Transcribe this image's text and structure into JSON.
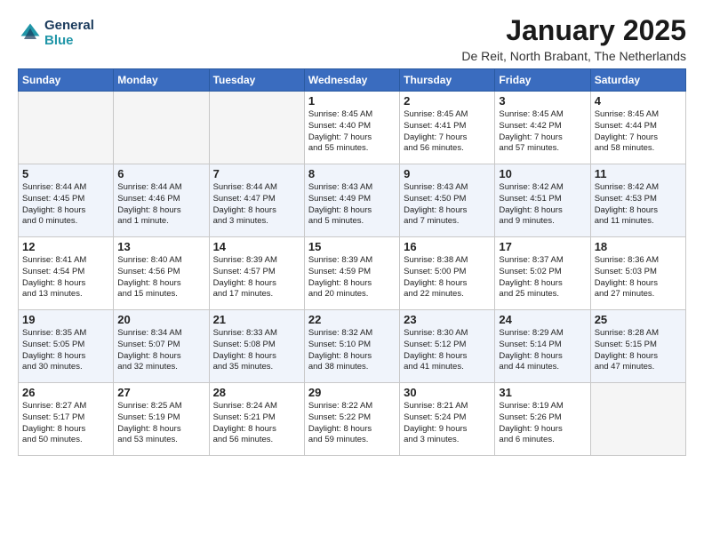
{
  "header": {
    "logo_line1": "General",
    "logo_line2": "Blue",
    "title": "January 2025",
    "subtitle": "De Reit, North Brabant, The Netherlands"
  },
  "weekdays": [
    "Sunday",
    "Monday",
    "Tuesday",
    "Wednesday",
    "Thursday",
    "Friday",
    "Saturday"
  ],
  "weeks": [
    [
      {
        "day": "",
        "info": ""
      },
      {
        "day": "",
        "info": ""
      },
      {
        "day": "",
        "info": ""
      },
      {
        "day": "1",
        "info": "Sunrise: 8:45 AM\nSunset: 4:40 PM\nDaylight: 7 hours\nand 55 minutes."
      },
      {
        "day": "2",
        "info": "Sunrise: 8:45 AM\nSunset: 4:41 PM\nDaylight: 7 hours\nand 56 minutes."
      },
      {
        "day": "3",
        "info": "Sunrise: 8:45 AM\nSunset: 4:42 PM\nDaylight: 7 hours\nand 57 minutes."
      },
      {
        "day": "4",
        "info": "Sunrise: 8:45 AM\nSunset: 4:44 PM\nDaylight: 7 hours\nand 58 minutes."
      }
    ],
    [
      {
        "day": "5",
        "info": "Sunrise: 8:44 AM\nSunset: 4:45 PM\nDaylight: 8 hours\nand 0 minutes."
      },
      {
        "day": "6",
        "info": "Sunrise: 8:44 AM\nSunset: 4:46 PM\nDaylight: 8 hours\nand 1 minute."
      },
      {
        "day": "7",
        "info": "Sunrise: 8:44 AM\nSunset: 4:47 PM\nDaylight: 8 hours\nand 3 minutes."
      },
      {
        "day": "8",
        "info": "Sunrise: 8:43 AM\nSunset: 4:49 PM\nDaylight: 8 hours\nand 5 minutes."
      },
      {
        "day": "9",
        "info": "Sunrise: 8:43 AM\nSunset: 4:50 PM\nDaylight: 8 hours\nand 7 minutes."
      },
      {
        "day": "10",
        "info": "Sunrise: 8:42 AM\nSunset: 4:51 PM\nDaylight: 8 hours\nand 9 minutes."
      },
      {
        "day": "11",
        "info": "Sunrise: 8:42 AM\nSunset: 4:53 PM\nDaylight: 8 hours\nand 11 minutes."
      }
    ],
    [
      {
        "day": "12",
        "info": "Sunrise: 8:41 AM\nSunset: 4:54 PM\nDaylight: 8 hours\nand 13 minutes."
      },
      {
        "day": "13",
        "info": "Sunrise: 8:40 AM\nSunset: 4:56 PM\nDaylight: 8 hours\nand 15 minutes."
      },
      {
        "day": "14",
        "info": "Sunrise: 8:39 AM\nSunset: 4:57 PM\nDaylight: 8 hours\nand 17 minutes."
      },
      {
        "day": "15",
        "info": "Sunrise: 8:39 AM\nSunset: 4:59 PM\nDaylight: 8 hours\nand 20 minutes."
      },
      {
        "day": "16",
        "info": "Sunrise: 8:38 AM\nSunset: 5:00 PM\nDaylight: 8 hours\nand 22 minutes."
      },
      {
        "day": "17",
        "info": "Sunrise: 8:37 AM\nSunset: 5:02 PM\nDaylight: 8 hours\nand 25 minutes."
      },
      {
        "day": "18",
        "info": "Sunrise: 8:36 AM\nSunset: 5:03 PM\nDaylight: 8 hours\nand 27 minutes."
      }
    ],
    [
      {
        "day": "19",
        "info": "Sunrise: 8:35 AM\nSunset: 5:05 PM\nDaylight: 8 hours\nand 30 minutes."
      },
      {
        "day": "20",
        "info": "Sunrise: 8:34 AM\nSunset: 5:07 PM\nDaylight: 8 hours\nand 32 minutes."
      },
      {
        "day": "21",
        "info": "Sunrise: 8:33 AM\nSunset: 5:08 PM\nDaylight: 8 hours\nand 35 minutes."
      },
      {
        "day": "22",
        "info": "Sunrise: 8:32 AM\nSunset: 5:10 PM\nDaylight: 8 hours\nand 38 minutes."
      },
      {
        "day": "23",
        "info": "Sunrise: 8:30 AM\nSunset: 5:12 PM\nDaylight: 8 hours\nand 41 minutes."
      },
      {
        "day": "24",
        "info": "Sunrise: 8:29 AM\nSunset: 5:14 PM\nDaylight: 8 hours\nand 44 minutes."
      },
      {
        "day": "25",
        "info": "Sunrise: 8:28 AM\nSunset: 5:15 PM\nDaylight: 8 hours\nand 47 minutes."
      }
    ],
    [
      {
        "day": "26",
        "info": "Sunrise: 8:27 AM\nSunset: 5:17 PM\nDaylight: 8 hours\nand 50 minutes."
      },
      {
        "day": "27",
        "info": "Sunrise: 8:25 AM\nSunset: 5:19 PM\nDaylight: 8 hours\nand 53 minutes."
      },
      {
        "day": "28",
        "info": "Sunrise: 8:24 AM\nSunset: 5:21 PM\nDaylight: 8 hours\nand 56 minutes."
      },
      {
        "day": "29",
        "info": "Sunrise: 8:22 AM\nSunset: 5:22 PM\nDaylight: 8 hours\nand 59 minutes."
      },
      {
        "day": "30",
        "info": "Sunrise: 8:21 AM\nSunset: 5:24 PM\nDaylight: 9 hours\nand 3 minutes."
      },
      {
        "day": "31",
        "info": "Sunrise: 8:19 AM\nSunset: 5:26 PM\nDaylight: 9 hours\nand 6 minutes."
      },
      {
        "day": "",
        "info": ""
      }
    ]
  ]
}
